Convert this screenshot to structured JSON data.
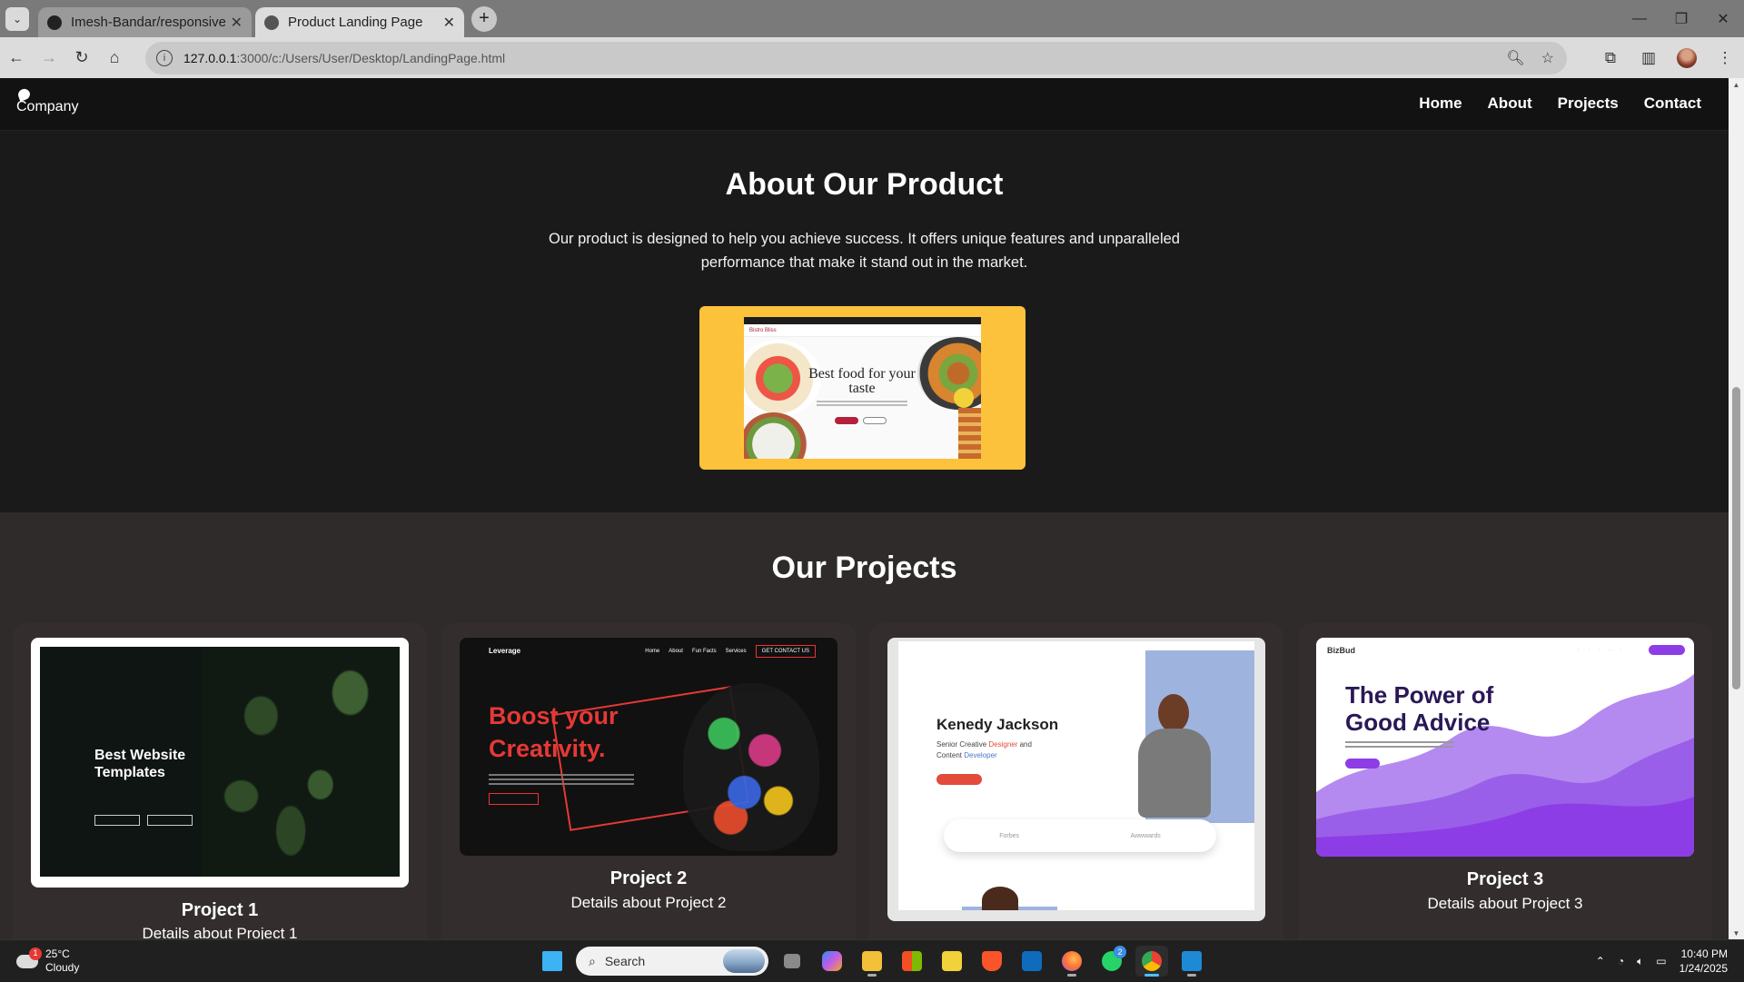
{
  "browser": {
    "tabs": [
      {
        "title": "Imesh-Bandar/responsive-web",
        "active": false
      },
      {
        "title": "Product Landing Page",
        "active": true
      }
    ],
    "url_host": "127.0.0.1",
    "url_path": ":3000/c:/Users/User/Desktop/LandingPage.html"
  },
  "site": {
    "logo_text": "Company",
    "nav": [
      "Home",
      "About",
      "Projects",
      "Contact"
    ],
    "about": {
      "title": "About Our Product",
      "description": "Our product is designed to help you achieve success. It offers unique features and unparalleled performance that make it stand out in the market.",
      "image": {
        "headline": "Best food for your taste",
        "brand": "Bistro Bliss",
        "accent": "#fdc23b"
      }
    },
    "projects": {
      "title": "Our Projects",
      "cards": [
        {
          "name": "Project 1",
          "details": "Details about Project 1",
          "thumb_headline": "Best Website Templates"
        },
        {
          "name": "Project 2",
          "details": "Details about Project 2",
          "thumb_brand": "Leverage",
          "thumb_headline": "Boost your Creativity.",
          "thumb_menu": [
            "Home",
            "About",
            "Fun Facts",
            "Services"
          ],
          "thumb_cta": "GET CONTACT US"
        },
        {
          "thumb_name": "Kenedy Jackson",
          "thumb_role_parts": [
            "Senior Creative ",
            "Designer",
            " and",
            "Content ",
            "Developer"
          ],
          "thumb_logos": [
            "Forbes",
            "Awwwards"
          ]
        },
        {
          "name": "Project 3",
          "details": "Details about Project 3",
          "thumb_brand": "BizBud",
          "thumb_headline": "The Power of Good Advice"
        }
      ]
    }
  },
  "taskbar": {
    "weather_temp": "25°C",
    "weather_desc": "Cloudy",
    "weather_badge": "1",
    "search_placeholder": "Search",
    "time": "10:40 PM",
    "date": "1/24/2025",
    "whatsapp_badge": "2"
  },
  "colors": {
    "accent_red": "#e53935",
    "accent_purple": "#8d3de6",
    "page_bg": "#1a1a1a",
    "projects_bg": "#2f2b2a"
  }
}
